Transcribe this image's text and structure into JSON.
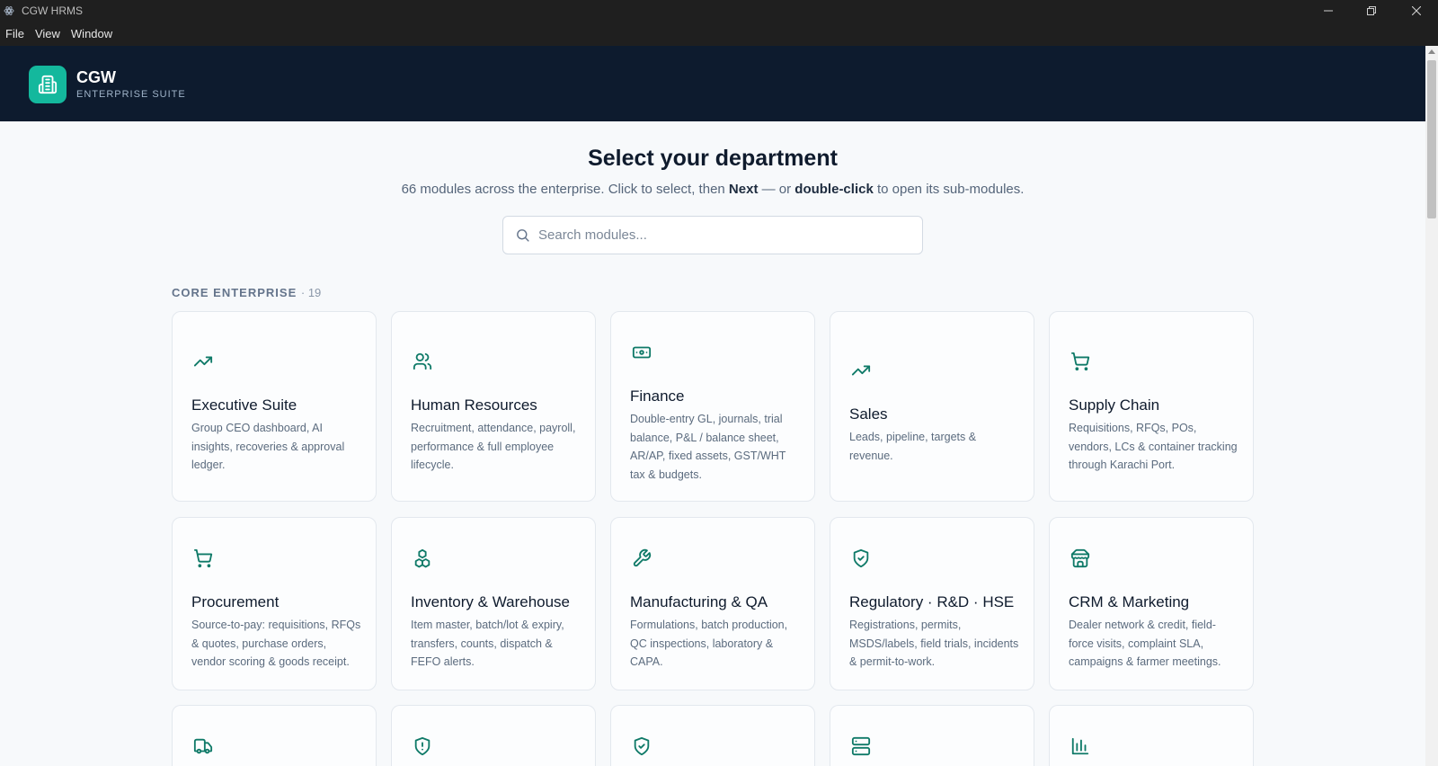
{
  "window": {
    "title": "CGW HRMS"
  },
  "menu": [
    "File",
    "View",
    "Window"
  ],
  "brand": {
    "name": "CGW",
    "subtitle": "ENTERPRISE SUITE"
  },
  "main": {
    "heading": "Select your department",
    "subheading": {
      "prefix": "66 modules across the enterprise. Click to select, then ",
      "next": "Next",
      "middle": " — or ",
      "dblclick": "double-click",
      "suffix": " to open its sub-modules."
    },
    "search_placeholder": "Search modules...",
    "section": {
      "label": "CORE ENTERPRISE",
      "count": "· 19"
    }
  },
  "accent_color": "#0f7a68",
  "cards": [
    {
      "name": "Executive Suite",
      "icon": "trending-up-icon",
      "desc": "Group CEO dashboard, AI insights, recoveries & approval ledger."
    },
    {
      "name": "Human Resources",
      "icon": "users-icon",
      "desc": "Recruitment, attendance, payroll, performance & full employee lifecycle."
    },
    {
      "name": "Finance",
      "icon": "banknote-icon",
      "desc": "Double-entry GL, journals, trial balance, P&L / balance sheet, AR/AP, fixed assets, GST/WHT tax & budgets."
    },
    {
      "name": "Sales",
      "icon": "trending-up-icon",
      "desc": "Leads, pipeline, targets & revenue."
    },
    {
      "name": "Supply Chain",
      "icon": "cart-icon",
      "desc": "Requisitions, RFQs, POs, vendors, LCs & container tracking through Karachi Port."
    },
    {
      "name": "Procurement",
      "icon": "cart-icon",
      "desc": "Source-to-pay: requisitions, RFQs & quotes, purchase orders, vendor scoring & goods receipt."
    },
    {
      "name": "Inventory & Warehouse",
      "icon": "boxes-icon",
      "desc": "Item master, batch/lot & expiry, transfers, counts, dispatch & FEFO alerts."
    },
    {
      "name": "Manufacturing & QA",
      "icon": "wrench-icon",
      "desc": "Formulations, batch production, QC inspections, laboratory & CAPA."
    },
    {
      "name": "Regulatory · R&D · HSE",
      "icon": "shield-check-icon",
      "desc": "Registrations, permits, MSDS/labels, field trials, incidents & permit-to-work."
    },
    {
      "name": "CRM & Marketing",
      "icon": "store-icon",
      "desc": "Dealer network & credit, field-force visits, complaint SLA, campaigns & farmer meetings."
    },
    {
      "name": "",
      "icon": "truck-icon",
      "desc": ""
    },
    {
      "name": "",
      "icon": "shield-alert-icon",
      "desc": ""
    },
    {
      "name": "",
      "icon": "shield-check-icon",
      "desc": ""
    },
    {
      "name": "",
      "icon": "server-icon",
      "desc": ""
    },
    {
      "name": "",
      "icon": "bar-chart-icon",
      "desc": ""
    }
  ]
}
